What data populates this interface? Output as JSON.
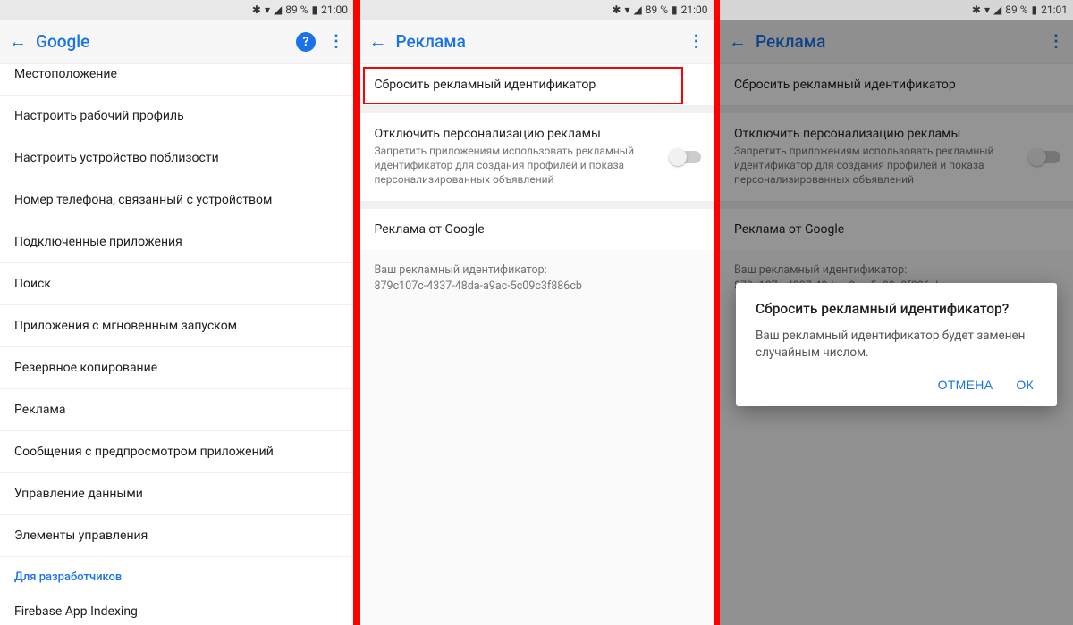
{
  "status": {
    "bluetooth": "✱",
    "wifi": "▾",
    "signal": "◢",
    "battery_pct": "89 %",
    "battery_icon": "▮",
    "time_a": "21:00",
    "time_c": "21:01"
  },
  "pane1": {
    "title": "Google",
    "items": [
      "Местоположение",
      "Настроить рабочий профиль",
      "Настроить устройство поблизости",
      "Номер телефона, связанный с устройством",
      "Подключенные приложения",
      "Поиск",
      "Приложения с мгновенным запуском",
      "Резервное копирование",
      "Реклама",
      "Сообщения с предпросмотром приложений",
      "Управление данными",
      "Элементы управления"
    ],
    "section_dev": "Для разработчиков",
    "dev_item": "Firebase App Indexing"
  },
  "pane2": {
    "title": "Реклама",
    "reset_label": "Сбросить рекламный идентификатор",
    "optout_title": "Отключить персонализацию рекламы",
    "optout_sub": "Запретить приложениям использовать рекламный идентификатор для создания профилей и показа персонализированных объявлений",
    "ads_by": "Реклама от Google",
    "id_label": "Ваш рекламный идентификатор:",
    "id_value": "879c107c-4337-48da-a9ac-5c09c3f886cb"
  },
  "pane3": {
    "title": "Реклама",
    "dialog_title": "Сбросить рекламный идентификатор?",
    "dialog_msg": "Ваш рекламный идентификатор будет заменен случайным числом.",
    "btn_cancel": "ОТМЕНА",
    "btn_ok": "ОК"
  }
}
